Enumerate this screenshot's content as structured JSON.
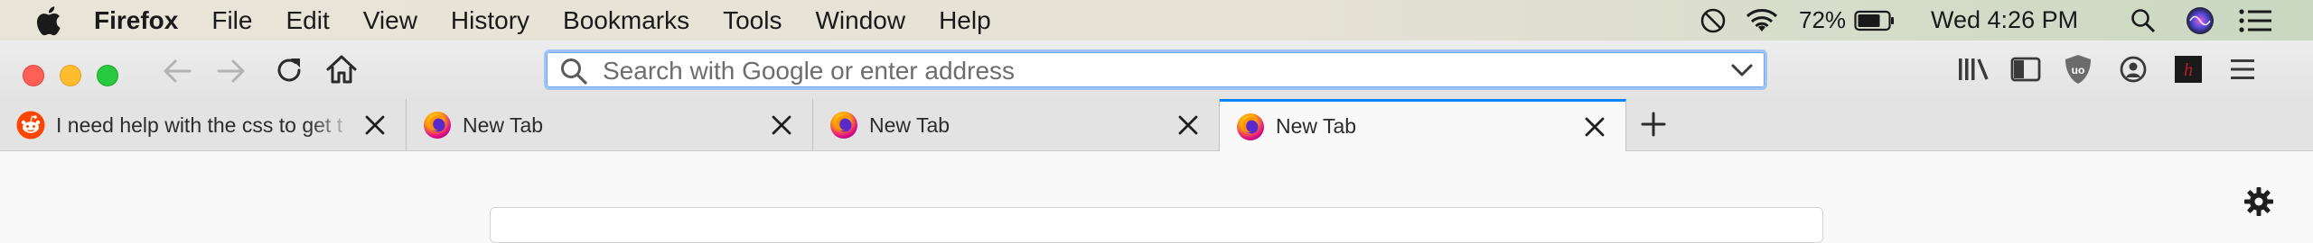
{
  "menubar": {
    "app_name": "Firefox",
    "items": [
      "File",
      "Edit",
      "View",
      "History",
      "Bookmarks",
      "Tools",
      "Window",
      "Help"
    ],
    "battery_percent": "72%",
    "clock": "Wed 4:26 PM"
  },
  "urlbar": {
    "placeholder": "Search with Google or enter address"
  },
  "tabs": [
    {
      "title": "I need help with the css to get t",
      "icon": "reddit-icon",
      "selected": false
    },
    {
      "title": "New Tab",
      "icon": "firefox-icon",
      "selected": false
    },
    {
      "title": "New Tab",
      "icon": "firefox-icon",
      "selected": false
    },
    {
      "title": "New Tab",
      "icon": "firefox-icon",
      "selected": true
    }
  ],
  "colors": {
    "tab_accent": "#0a84ff",
    "urlbar_focus": "#9fc4f4",
    "close_red": "#fe5f57",
    "minimize_yellow": "#febc2e",
    "zoom_green": "#28c840"
  }
}
